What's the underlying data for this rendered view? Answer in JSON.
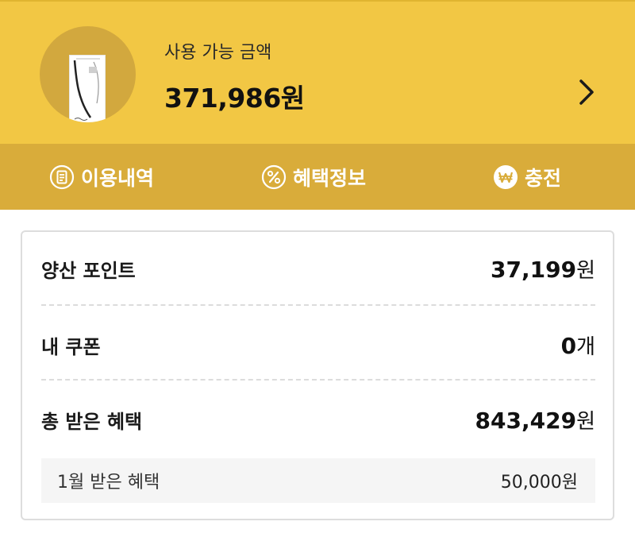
{
  "header": {
    "balance_label": "사용 가능 금액",
    "balance_amount": "371,986원"
  },
  "actions": [
    {
      "label": "이용내역",
      "icon": "receipt-icon"
    },
    {
      "label": "혜택정보",
      "icon": "percent-icon"
    },
    {
      "label": "충전",
      "icon": "won-icon"
    }
  ],
  "summary": {
    "points": {
      "label": "양산 포인트",
      "value": "37,199",
      "unit": "원"
    },
    "coupons": {
      "label": "내 쿠폰",
      "value": "0",
      "unit": "개"
    },
    "total_benefits": {
      "label": "총 받은 혜택",
      "value": "843,429",
      "unit": "원"
    },
    "monthly_benefit": {
      "label": "1월 받은 혜택",
      "value": "50,000원"
    }
  },
  "colors": {
    "header_bg": "#f2c744",
    "action_bar_bg": "#d9ac3a",
    "card_circle_bg": "#d2a83e"
  }
}
